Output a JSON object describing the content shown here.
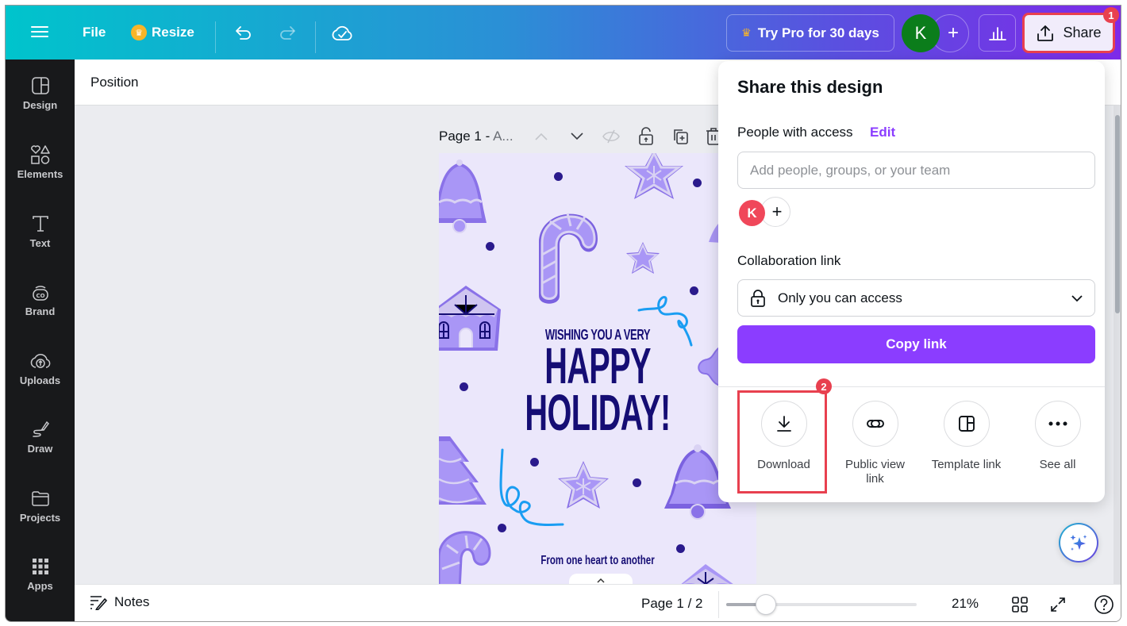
{
  "topbar": {
    "menu_icon": "hamburger-icon",
    "file_label": "File",
    "resize_label": "Resize",
    "undo_icon": "undo-icon",
    "redo_icon": "redo-icon",
    "save_status_icon": "cloud-check-icon",
    "try_pro_label": "Try Pro for 30 days",
    "user_initial": "K",
    "add_user_symbol": "+",
    "analytics_icon": "bar-chart-icon",
    "share_label": "Share",
    "share_badge": "1",
    "colors": {
      "gradient_start": "#00c4cc",
      "gradient_end": "#7d2ae8",
      "avatar": "#0b7d1b",
      "highlight": "#e8404f"
    }
  },
  "sidebar": {
    "items": [
      {
        "label": "Design",
        "icon": "design-layout-icon"
      },
      {
        "label": "Elements",
        "icon": "shapes-icon"
      },
      {
        "label": "Text",
        "icon": "text-icon"
      },
      {
        "label": "Brand",
        "icon": "brand-icon"
      },
      {
        "label": "Uploads",
        "icon": "cloud-upload-icon"
      },
      {
        "label": "Draw",
        "icon": "pen-draw-icon"
      },
      {
        "label": "Projects",
        "icon": "folder-icon"
      },
      {
        "label": "Apps",
        "icon": "apps-grid-icon"
      }
    ]
  },
  "context_bar": {
    "position_label": "Position"
  },
  "canvas": {
    "page_title_main": "Page 1 - ",
    "page_title_rest": "A...",
    "design": {
      "line1": "WISHING YOU A VERY",
      "line2": "HAPPY",
      "line3": "HOLIDAY!",
      "line4": "From one heart to another",
      "bg_color": "#ebe7fb",
      "text_color": "#150d74"
    },
    "expand_symbol": "^"
  },
  "share_panel": {
    "title": "Share this design",
    "people_label": "People with access",
    "edit_label": "Edit",
    "add_people_placeholder": "Add people, groups, or your team",
    "add_people_value": "",
    "member_initial": "K",
    "add_member_symbol": "+",
    "collab_label": "Collaboration link",
    "access_value": "Only you can access",
    "copy_link_label": "Copy link",
    "options": [
      {
        "label": "Download",
        "icon": "download-icon"
      },
      {
        "label": "Public view link",
        "icon": "link-icon"
      },
      {
        "label": "Template link",
        "icon": "template-icon"
      },
      {
        "label": "See all",
        "icon": "more-dots-icon"
      }
    ],
    "download_badge": "2",
    "accent_color": "#8b3dff"
  },
  "footer": {
    "notes_label": "Notes",
    "page_count": "Page 1 / 2",
    "zoom_value": "21%",
    "zoom_fraction": 0.21
  }
}
